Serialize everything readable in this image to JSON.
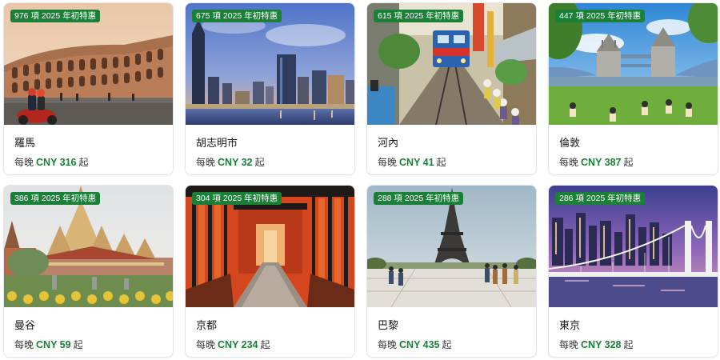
{
  "theme": {
    "accent": "#1a7f37",
    "badge_bg": "#1a7f37"
  },
  "cards": [
    {
      "city": "羅馬",
      "badge": "976 項 2025 年初特惠",
      "per_night": "每晚",
      "price": "CNY 316",
      "suffix": "起",
      "photo": "colosseum-photo"
    },
    {
      "city": "胡志明市",
      "badge": "675 項 2025 年初特惠",
      "per_night": "每晚",
      "price": "CNY 32",
      "suffix": "起",
      "photo": "saigon-skyline-photo"
    },
    {
      "city": "河內",
      "badge": "615 項 2025 年初特惠",
      "per_night": "每晚",
      "price": "CNY 41",
      "suffix": "起",
      "photo": "train-street-photo"
    },
    {
      "city": "倫敦",
      "badge": "447 項 2025 年初特惠",
      "per_night": "每晚",
      "price": "CNY 387",
      "suffix": "起",
      "photo": "tower-bridge-photo"
    },
    {
      "city": "曼谷",
      "badge": "386 項 2025 年初特惠",
      "per_night": "每晚",
      "price": "CNY 59",
      "suffix": "起",
      "photo": "temple-photo"
    },
    {
      "city": "京都",
      "badge": "304 項 2025 年初特惠",
      "per_night": "每晚",
      "price": "CNY 234",
      "suffix": "起",
      "photo": "torii-gates-photo"
    },
    {
      "city": "巴黎",
      "badge": "288 項 2025 年初特惠",
      "per_night": "每晚",
      "price": "CNY 435",
      "suffix": "起",
      "photo": "eiffel-tower-photo"
    },
    {
      "city": "東京",
      "badge": "286 項 2025 年初特惠",
      "per_night": "每晚",
      "price": "CNY 328",
      "suffix": "起",
      "photo": "rainbow-bridge-photo"
    }
  ]
}
